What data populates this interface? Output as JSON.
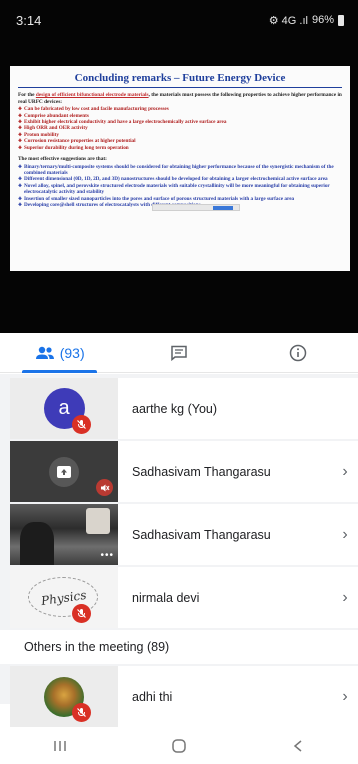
{
  "status_bar": {
    "time": "3:14",
    "signal": "⚙ 4G .ıl",
    "battery": "96%"
  },
  "slide": {
    "title": "Concluding remarks – Future Energy Device",
    "intro_prefix": "For the ",
    "intro_highlight": "design of efficient bifunctional electrode materials",
    "intro_suffix": ", the materials must possess the following properties to achieve higher performance in real URFC devices:",
    "properties": [
      "Can be fabricated by low cost and facile manufacturing processes",
      "Comprise abundant elements",
      "Exhibit higher electrical conductivity and have a large electrochemically active surface area",
      "High ORR and OER activity",
      "Proton mobility",
      "Corrosion resistance properties at higher potential",
      "Superior durability during long term operation"
    ],
    "suggestions_heading": "The most effective suggestions are that:",
    "suggestions": [
      "Binary/ternary/multi-composite systems should be considered for obtaining higher performance because of the synergistic mechanism of the combined materials",
      "Different dimensional (0D, 1D, 2D, and 3D) nanostructures should be developed for obtaining a larger electrochemical active surface area",
      "Novel alloy, spinel, and perovskite structured electrode materials with suitable crystallinity will be more meaningful for obtaining superior electrocatalytic activity and stability",
      "Insertion of smaller sized nanoparticles into the pores and surface of porous structured materials with a large surface area",
      "Developing core@shell structures of electrocatalysts with different compositions"
    ]
  },
  "tabs": {
    "people_count": "(93)"
  },
  "participants": [
    {
      "name": "aarthe kg (You)",
      "initial": "a"
    },
    {
      "name": "Sadhasivam Thangarasu"
    },
    {
      "name": "Sadhasivam Thangarasu"
    },
    {
      "name": "nirmala devi",
      "tile_text": "Physics"
    }
  ],
  "others_label": "Others in the meeting (89)",
  "others": [
    {
      "name": "adhi thi"
    }
  ],
  "colors": {
    "accent": "#1a73e8",
    "avatar": "#3e3bb8",
    "mute": "#d93025"
  }
}
